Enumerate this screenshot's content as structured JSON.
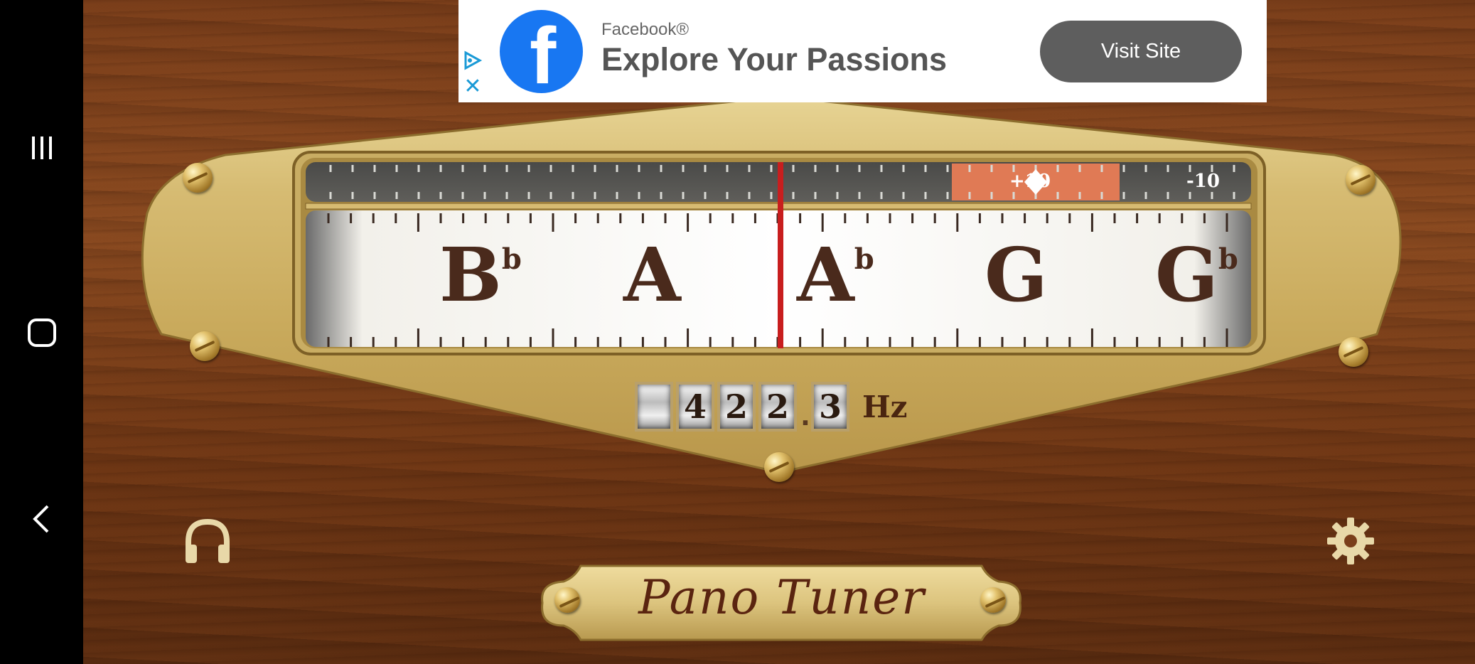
{
  "ad": {
    "sponsor": "Facebook®",
    "headline": "Explore Your Passions",
    "cta_label": "Visit Site",
    "logo_letter": "f"
  },
  "meter": {
    "plus_label": "+10",
    "minus_label": "-10",
    "pointer_cents": 0
  },
  "notes": [
    {
      "letter": "B",
      "accidental": "b"
    },
    {
      "letter": "A",
      "accidental": ""
    },
    {
      "letter": "A",
      "accidental": "b"
    },
    {
      "letter": "G",
      "accidental": ""
    },
    {
      "letter": "G",
      "accidental": "b"
    }
  ],
  "frequency": {
    "digits": [
      "",
      "4",
      "2",
      "2"
    ],
    "decimal": "3",
    "separator": ".",
    "unit": "Hz"
  },
  "app": {
    "title": "Pano Tuner"
  },
  "colors": {
    "brass": "#d8be78",
    "wood": "#7a3e1a",
    "accent_red": "#c81e1e",
    "cents_zone": "#e07a55",
    "note_text": "#4a2a1c"
  },
  "icons": {
    "headphones": "headphones-icon",
    "settings": "gear-icon"
  }
}
